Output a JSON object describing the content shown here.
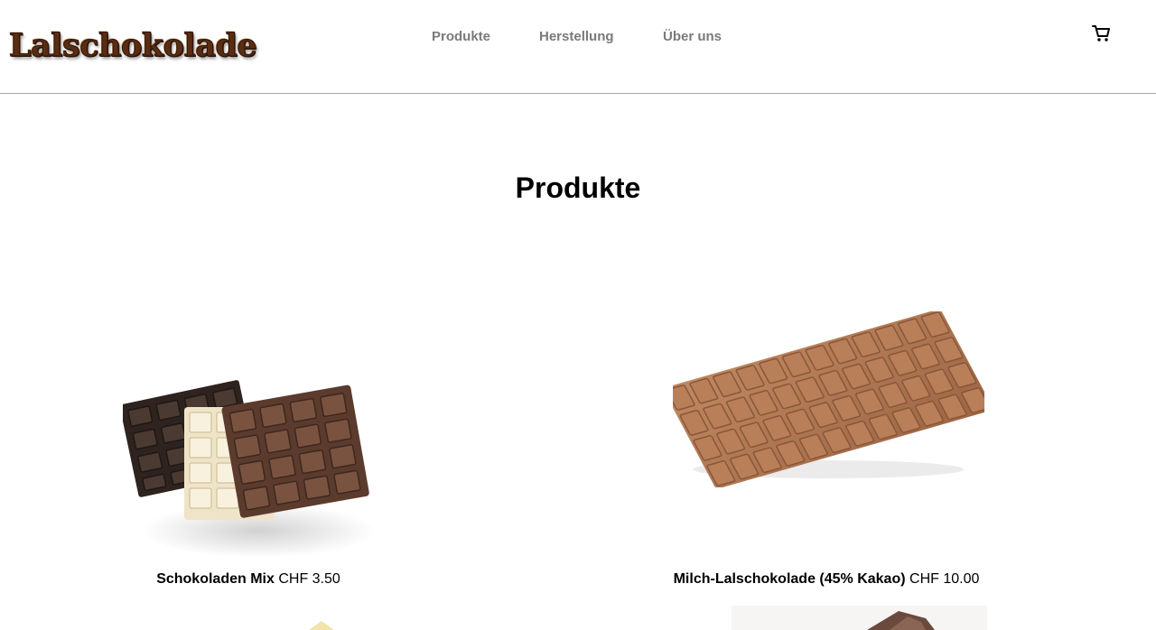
{
  "header": {
    "logo_text": "Lalschokolade",
    "nav": [
      {
        "label": "Produkte"
      },
      {
        "label": "Herstellung"
      },
      {
        "label": "Über uns"
      }
    ],
    "cart_icon": "shopping-cart-icon"
  },
  "main": {
    "title": "Produkte",
    "products": [
      {
        "name": "Schokoladen Mix",
        "price": "CHF 3.50",
        "image": "mixed-chocolate-bars"
      },
      {
        "name": "Milch-Lalschokolade (45% Kakao)",
        "price": "CHF 10.00",
        "image": "milk-chocolate-bar"
      }
    ]
  },
  "colors": {
    "logo": "#5a2d12",
    "nav_text": "#7a7a7a",
    "milk_chocolate": "#b27a55",
    "dark_chocolate": "#3b2a22",
    "white_chocolate": "#f3ead2",
    "medium_chocolate": "#6e4a38"
  }
}
